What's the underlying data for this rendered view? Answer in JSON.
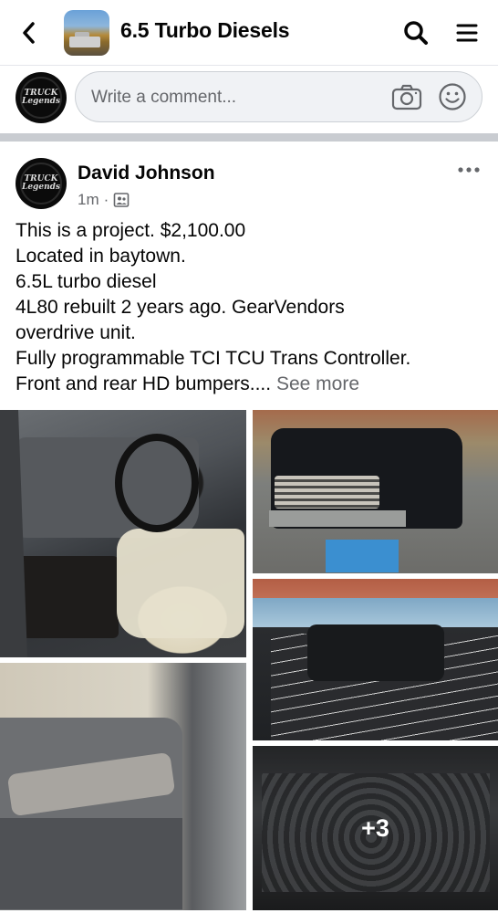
{
  "header": {
    "back_icon": "chevron-left-icon",
    "group_title": "6.5 Turbo Diesels",
    "search_icon": "search-icon",
    "menu_icon": "hamburger-menu-icon"
  },
  "comment_bar": {
    "avatar_text": "TRUCK Legends",
    "placeholder": "Write a comment...",
    "camera_icon": "camera-icon",
    "emoji_icon": "emoji-icon"
  },
  "post": {
    "author": "David Johnson",
    "avatar_text": "TRUCK Legends",
    "time": "1m",
    "separator": "·",
    "privacy_icon": "group-members-icon",
    "more_icon": "more-horizontal-icon",
    "lines": [
      "This is a project. $2,100.00",
      "Located in baytown.",
      "6.5L turbo diesel",
      "4L80 rebuilt 2 years ago. GearVendors",
      "overdrive unit.",
      "Fully programmable TCI TCU Trans Controller.",
      "Front and rear HD bumpers...."
    ],
    "see_more": "See more",
    "photos": {
      "extra_count": "+3"
    }
  },
  "colors": {
    "secondary_text": "#65676b",
    "divider": "#c9ccd1",
    "input_bg": "#f0f2f5"
  }
}
